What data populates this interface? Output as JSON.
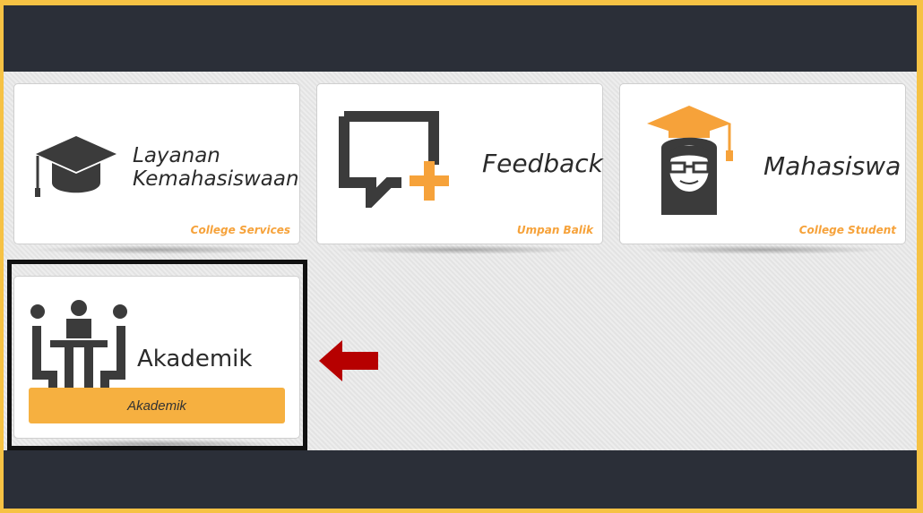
{
  "cards": [
    {
      "title_line1": "Layanan",
      "title_line2": "Kemahasiswaan",
      "subtitle": "College Services",
      "icon": "graduation-cap-icon"
    },
    {
      "title": "Feedback",
      "subtitle": "Umpan Balik",
      "icon": "chat-plus-icon"
    },
    {
      "title": "Mahasiswa",
      "subtitle": "College Student",
      "icon": "student-graduate-icon"
    },
    {
      "title": "Akademik",
      "bar_label": "Akademik",
      "icon": "meeting-people-icon"
    }
  ],
  "colors": {
    "accent": "#f6a23a",
    "dark_frame": "#2b2f38",
    "outer_border": "#f6c244",
    "arrow": "#b60000"
  },
  "annotation": {
    "arrow_icon": "left-arrow-icon"
  }
}
